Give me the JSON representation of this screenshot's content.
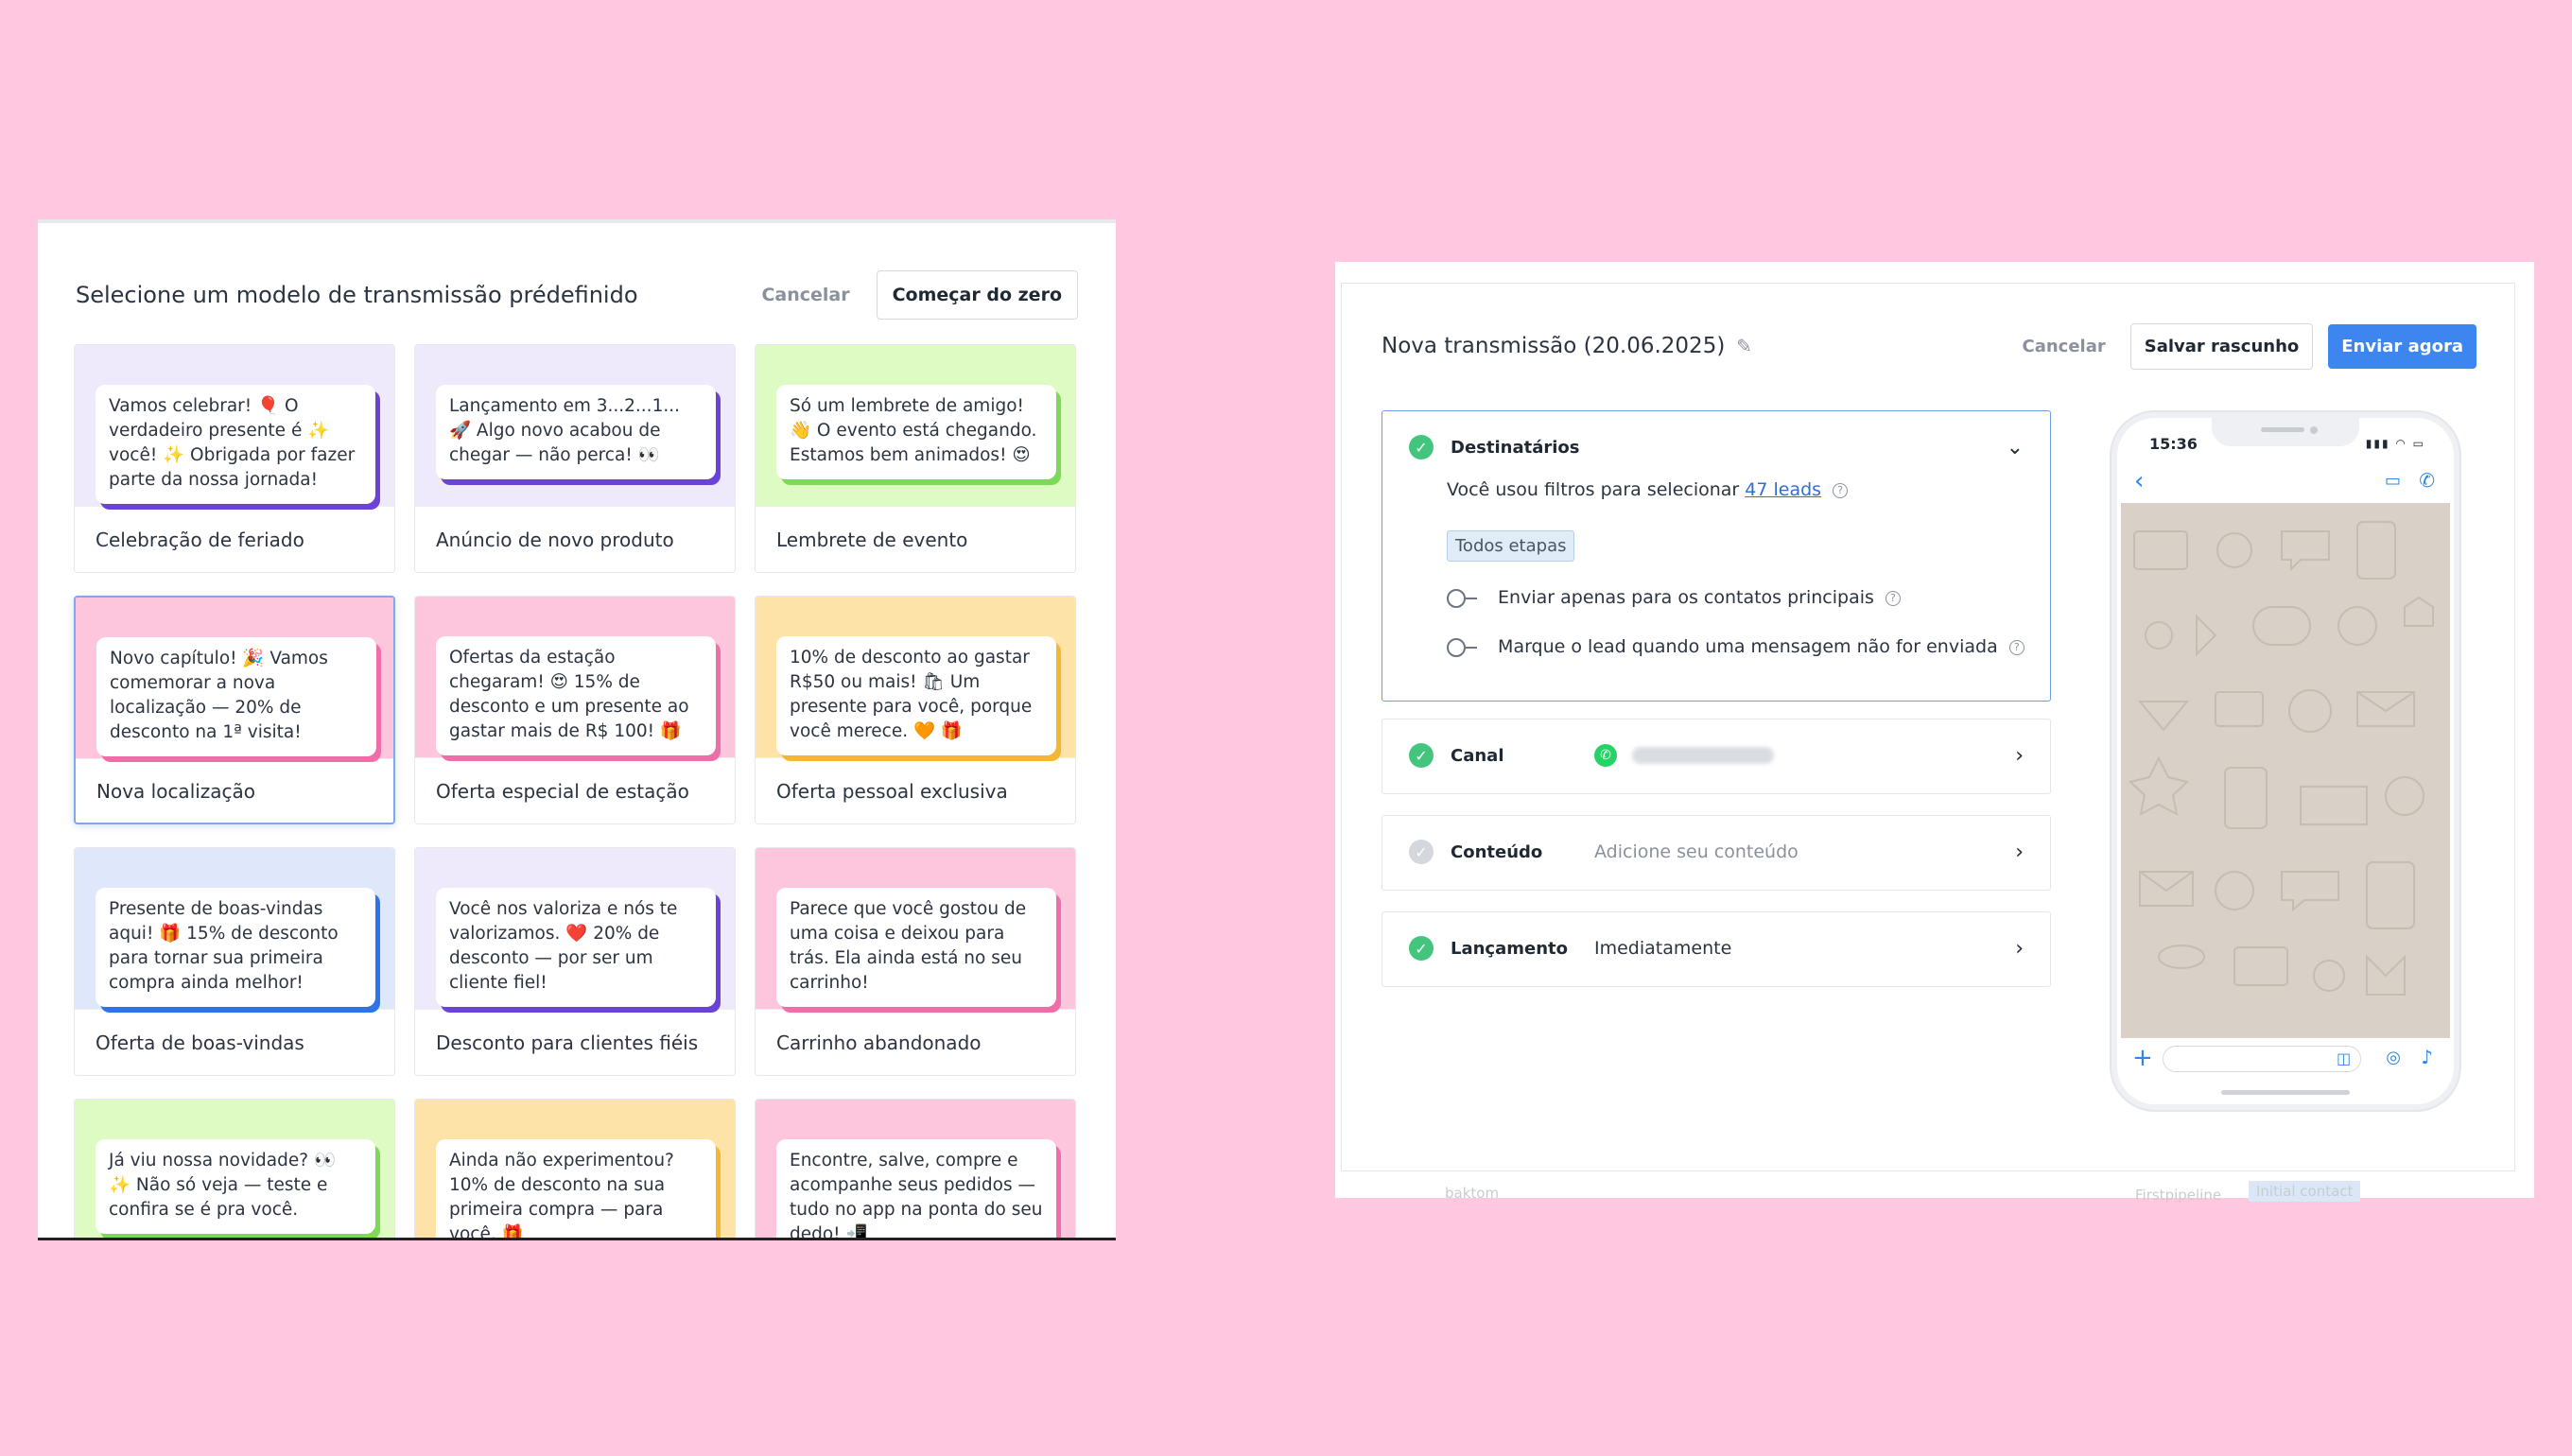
{
  "left": {
    "title": "Selecione um modelo de transmissão prédefinido",
    "cancel_label": "Cancelar",
    "start_label": "Começar do zero",
    "templates": [
      {
        "message": "Vamos celebrar! 🎈 O verdadeiro presente é ✨ você! ✨ Obrigada por fazer parte da nossa jornada!",
        "name": "Celebração de feriado",
        "bg": "#eeeafb",
        "accent": "#6a43d6"
      },
      {
        "message": "Lançamento em 3...2...1... 🚀 Algo novo acabou de chegar — não perca! 👀",
        "name": "Anúncio de novo produto",
        "bg": "#eeeafb",
        "accent": "#6a43d6"
      },
      {
        "message": "Só um lembrete de amigo! 👋 O evento está chegando. Estamos bem animados! 😍",
        "name": "Lembrete de evento",
        "bg": "#dffbc4",
        "accent": "#7ed957"
      },
      {
        "message": "Novo capítulo! 🎉 Vamos comemorar a nova localização — 20% de desconto na 1ª visita!",
        "name": "Nova localização",
        "bg": "#fec6dd",
        "accent": "#f06ea8"
      },
      {
        "message": "Ofertas da estação chegaram! 😍 15% de desconto e um presente ao gastar mais de R$ 100! 🎁",
        "name": "Oferta especial de estação",
        "bg": "#fec6dd",
        "accent": "#f06ea8"
      },
      {
        "message": "10% de desconto ao gastar R$50 ou mais! 🛍 Um presente para você, porque você merece. 🧡 🎁",
        "name": "Oferta pessoal exclusiva",
        "bg": "#fde3a8",
        "accent": "#f5b731"
      },
      {
        "message": "Presente de boas-vindas aqui! 🎁 15% de desconto para tornar sua primeira compra ainda melhor!",
        "name": "Oferta de boas-vindas",
        "bg": "#dfe8fb",
        "accent": "#2d73ea"
      },
      {
        "message": "Você nos valoriza e nós te valorizamos. ❤️ 20% de desconto — por ser um cliente fiel!",
        "name": "Desconto para clientes fiéis",
        "bg": "#eeeafb",
        "accent": "#6a43d6"
      },
      {
        "message": "Parece que você gostou de uma coisa e deixou para trás. Ela ainda está no seu carrinho!",
        "name": "Carrinho abandonado",
        "bg": "#fec6dd",
        "accent": "#f06ea8"
      },
      {
        "message": "Já viu nossa novidade? 👀 ✨ Não só veja — teste e confira se é pra você.",
        "name": "",
        "bg": "#dffbc4",
        "accent": "#7ed957"
      },
      {
        "message": "Ainda não experimentou? 10% de desconto na sua primeira compra — para você. 🎁",
        "name": "",
        "bg": "#fde3a8",
        "accent": "#f5b731"
      },
      {
        "message": "Encontre, salve, compre e acompanhe seus pedidos — tudo no app na ponta do seu dedo! 📲",
        "name": "",
        "bg": "#fec6dd",
        "accent": "#f06ea8"
      }
    ]
  },
  "right": {
    "title": "Nova transmissão (20.06.2025)",
    "cancel_label": "Cancelar",
    "draft_label": "Salvar rascunho",
    "send_label": "Enviar agora",
    "recipients": {
      "label": "Destinatários",
      "filter_prefix": "Você usou filtros para selecionar",
      "leads_link": "47 leads",
      "stage_tag": "Todos etapas",
      "option1": "Enviar apenas para os contatos principais",
      "option2": "Marque o lead quando uma mensagem não for enviada"
    },
    "channel": {
      "label": "Canal",
      "value": ""
    },
    "content": {
      "label": "Conteúdo",
      "value": "Adicione seu conteúdo"
    },
    "launch": {
      "label": "Lançamento",
      "value": "Imediatamente"
    },
    "phone": {
      "time": "15:36"
    },
    "footer_faint_1": "baktom",
    "footer_faint_2": "Firstpipeline",
    "footer_faint_3": "Initial contact"
  },
  "colors": {
    "background": "#ffc8e0",
    "primary": "#3d86f0",
    "success": "#44c57e"
  }
}
